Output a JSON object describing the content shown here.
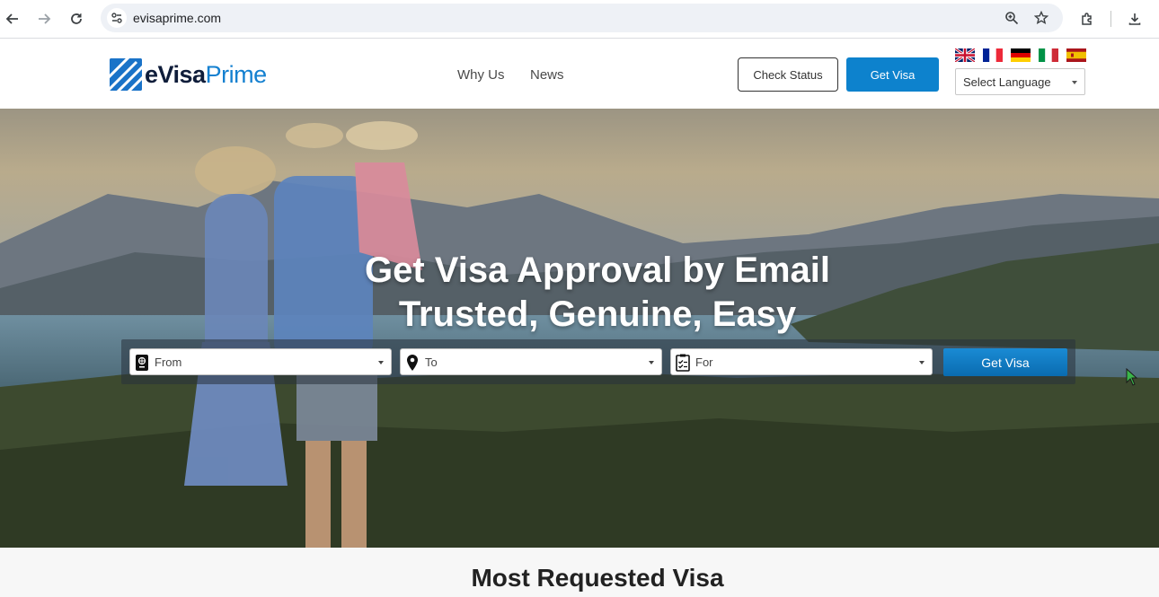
{
  "browser": {
    "url": "evisaprime.com",
    "icons": [
      "back-icon",
      "forward-icon",
      "reload-icon",
      "site-info-icon",
      "zoom-icon",
      "bookmark-star-icon",
      "extensions-icon",
      "download-icon"
    ]
  },
  "header": {
    "logo": {
      "brand_a": "eVisa",
      "brand_b": "Prime"
    },
    "nav": [
      "Why Us",
      "News"
    ],
    "check_status_label": "Check Status",
    "get_visa_label": "Get Visa",
    "flags": [
      "uk-flag",
      "france-flag",
      "germany-flag",
      "italy-flag",
      "spain-flag"
    ],
    "language_select": "Select Language"
  },
  "hero": {
    "title_line1": "Get Visa Approval by Email",
    "title_line2": "Trusted, Genuine, Easy",
    "search": {
      "from_label": "From",
      "to_label": "To",
      "for_label": "For",
      "button_label": "Get Visa"
    }
  },
  "section": {
    "title": "Most Requested Visa"
  },
  "colors": {
    "brand_blue": "#0d82cd",
    "logo_navy": "#0f1d3a"
  }
}
